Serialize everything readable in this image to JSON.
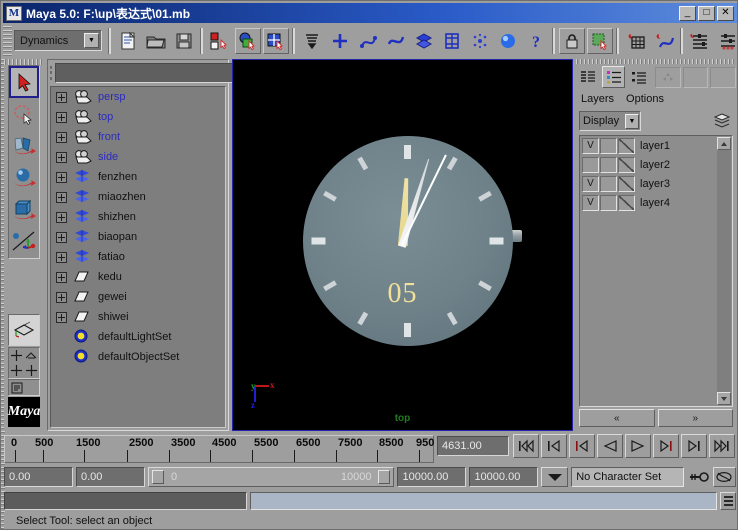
{
  "window": {
    "title": "Maya 5.0: F:\\up\\表达式\\01.mb",
    "app_icon": "maya-icon",
    "minimize": "_",
    "maximize": "□",
    "close": "✕"
  },
  "toolbar": {
    "menu_set": "Dynamics",
    "menu_set_arrow": "▼",
    "buttons": [
      {
        "name": "new-scene-button",
        "icon": "new-file-icon"
      },
      {
        "name": "open-scene-button",
        "icon": "folder-open-icon"
      },
      {
        "name": "save-scene-button",
        "icon": "floppy-save-icon"
      },
      {
        "name": "select-by-hierarchy-button",
        "icon": "hierarchy-select-icon"
      },
      {
        "name": "select-by-object-type-button",
        "icon": "object-select-icon"
      },
      {
        "name": "select-by-component-type-button",
        "icon": "component-select-icon"
      },
      {
        "name": "selection-mask-button",
        "icon": "mask-icon"
      },
      {
        "name": "select-handle-button",
        "icon": "plus-handle-icon"
      },
      {
        "name": "select-curve-button",
        "icon": "curve-icon"
      },
      {
        "name": "select-surface-button",
        "icon": "surface-icon"
      },
      {
        "name": "select-poly-button",
        "icon": "poly-icon"
      },
      {
        "name": "select-deformation-button",
        "icon": "lattice-icon"
      },
      {
        "name": "select-dynamic-button",
        "icon": "particle-icon"
      },
      {
        "name": "select-render-button",
        "icon": "render-sphere-icon"
      },
      {
        "name": "select-misc-button",
        "icon": "question-icon"
      },
      {
        "name": "snap-lock-button",
        "icon": "lock-icon"
      },
      {
        "name": "construction-history-button",
        "icon": "history-icon"
      },
      {
        "name": "snap-grid-button",
        "icon": "snap-grid-icon"
      },
      {
        "name": "snap-curve-button",
        "icon": "snap-curve-icon"
      },
      {
        "name": "show-attribute-editor-button",
        "icon": "attribute-editor-icon"
      },
      {
        "name": "show-tool-settings-button",
        "icon": "tool-settings-icon"
      },
      {
        "name": "show-channel-box-button",
        "icon": "channel-box-icon"
      }
    ]
  },
  "toolbox": {
    "tools": [
      {
        "name": "select-tool",
        "icon": "arrow-cursor-icon",
        "selected": true
      },
      {
        "name": "lasso-tool",
        "icon": "lasso-icon",
        "selected": false
      },
      {
        "name": "move-tool",
        "icon": "move-arrow-icon",
        "selected": false
      },
      {
        "name": "rotate-tool",
        "icon": "rotate-sphere-icon",
        "selected": false
      },
      {
        "name": "scale-tool",
        "icon": "scale-cube-icon",
        "selected": false
      },
      {
        "name": "universal-manipulator-tool",
        "icon": "manipulator-icon",
        "selected": false
      }
    ],
    "layouts": [
      {
        "name": "single-perspective-layout",
        "icon": "single-view-icon"
      },
      {
        "name": "four-view-layout",
        "icon": "four-view-icon"
      },
      {
        "name": "persp-outliner-layout",
        "icon": "persp-outliner-icon"
      },
      {
        "name": "two-pane-layout",
        "icon": "two-pane-icon"
      },
      {
        "name": "hypergraph-layout",
        "icon": "hypergraph-icon"
      },
      {
        "name": "blank-layout",
        "icon": "blank-icon"
      }
    ],
    "logo_text": "Maya"
  },
  "outliner": {
    "search_value": "",
    "filter_icon": "filter-icon",
    "items": [
      {
        "label": "persp",
        "icon": "camera-icon",
        "kind": "camera",
        "expandable": true
      },
      {
        "label": "top",
        "icon": "camera-icon",
        "kind": "camera",
        "expandable": true
      },
      {
        "label": "front",
        "icon": "camera-icon",
        "kind": "camera",
        "expandable": true
      },
      {
        "label": "side",
        "icon": "camera-icon",
        "kind": "camera",
        "expandable": true
      },
      {
        "label": "fenzhen",
        "icon": "mesh-icon",
        "kind": "mesh",
        "expandable": true
      },
      {
        "label": "miaozhen",
        "icon": "mesh-icon",
        "kind": "mesh",
        "expandable": true
      },
      {
        "label": "shizhen",
        "icon": "mesh-icon",
        "kind": "mesh",
        "expandable": true
      },
      {
        "label": "biaopan",
        "icon": "mesh-icon",
        "kind": "mesh",
        "expandable": true
      },
      {
        "label": "fatiao",
        "icon": "mesh-icon",
        "kind": "mesh",
        "expandable": true
      },
      {
        "label": "kedu",
        "icon": "plane-icon",
        "kind": "plane",
        "expandable": true
      },
      {
        "label": "gewei",
        "icon": "plane-icon",
        "kind": "plane",
        "expandable": true
      },
      {
        "label": "shiwei",
        "icon": "plane-icon",
        "kind": "plane",
        "expandable": true
      },
      {
        "label": "defaultLightSet",
        "icon": "set-icon",
        "kind": "set",
        "expandable": false
      },
      {
        "label": "defaultObjectSet",
        "icon": "set-icon",
        "kind": "set",
        "expandable": false
      }
    ]
  },
  "viewport": {
    "camera_label": "top",
    "axis_x": "x",
    "axis_y": "y",
    "axis_z": "z",
    "axis_x_color": "#c01818",
    "axis_y_color": "#18a018",
    "axis_z_color": "#2020d8",
    "background": "#000000",
    "clock": {
      "dial_color": "#6e8189",
      "number_text": "05",
      "number_color": "#f0e09a",
      "hour_hand_color": "#ece0a0",
      "minute_hand_color": "#e8eaec",
      "second_hand_color": "#ffffff",
      "hour_hand_angle_deg": 3,
      "minute_hand_angle_deg": 17,
      "second_hand_angle_deg": 26,
      "tick_count": 12
    }
  },
  "layer_editor": {
    "tabs": [
      {
        "name": "tab-display-layers",
        "icon": "list-lines-icon",
        "active": false
      },
      {
        "name": "tab-render-layers",
        "icon": "list-dots-icon",
        "active": true
      },
      {
        "name": "tab-anim-layers",
        "icon": "list-mixed-icon",
        "active": false
      }
    ],
    "extra_buttons": [
      {
        "name": "expand-collapse-button",
        "icon": "expand-icon"
      },
      {
        "name": "panel-blank-1",
        "icon": "blank-icon"
      },
      {
        "name": "panel-blank-2",
        "icon": "blank-icon"
      }
    ],
    "menus": [
      "Layers",
      "Options"
    ],
    "display_mode": "Display",
    "display_arrow": "▼",
    "new_layer_icon": "new-layer-icon",
    "scroll_up": "▲",
    "scroll_down": "▼",
    "layers": [
      {
        "name": "layer1",
        "visible": "V",
        "playback": "",
        "display_type": "normal"
      },
      {
        "name": "layer2",
        "visible": "",
        "playback": "",
        "display_type": "normal"
      },
      {
        "name": "layer3",
        "visible": "V",
        "playback": "",
        "display_type": "normal"
      },
      {
        "name": "layer4",
        "visible": "V",
        "playback": "",
        "display_type": "normal"
      }
    ],
    "prev_button": "«",
    "next_button": "»"
  },
  "time_slider": {
    "tick_labels": [
      "0",
      "500",
      "1500",
      "2500",
      "3500",
      "4500",
      "5500",
      "6500",
      "7500",
      "8500",
      "950"
    ],
    "current_time": "4631.00"
  },
  "transport": [
    {
      "name": "go-to-start-button",
      "icon": "skip-start-icon"
    },
    {
      "name": "step-back-key-button",
      "icon": "prev-key-icon"
    },
    {
      "name": "step-back-frame-button",
      "icon": "prev-frame-icon"
    },
    {
      "name": "play-backwards-button",
      "icon": "play-back-icon"
    },
    {
      "name": "play-forwards-button",
      "icon": "play-forward-icon"
    },
    {
      "name": "step-forward-frame-button",
      "icon": "next-frame-icon"
    },
    {
      "name": "step-forward-key-button",
      "icon": "next-key-icon"
    },
    {
      "name": "go-to-end-button",
      "icon": "skip-end-icon"
    }
  ],
  "range_slider": {
    "anim_start": "0.00",
    "range_start": "0.00",
    "bar_min": "0",
    "bar_max": "10000",
    "range_end": "10000.00",
    "anim_end": "10000.00",
    "character_set": "No Character Set",
    "dropdown_arrow": "▼",
    "auto_key_icon": "key-icon",
    "anim_prefs_icon": "anim-prefs-icon"
  },
  "command_line": {
    "input_value": "",
    "output_value": "",
    "script_editor_icon": "script-editor-icon"
  },
  "status_bar": {
    "message": "Select Tool: select an object"
  }
}
